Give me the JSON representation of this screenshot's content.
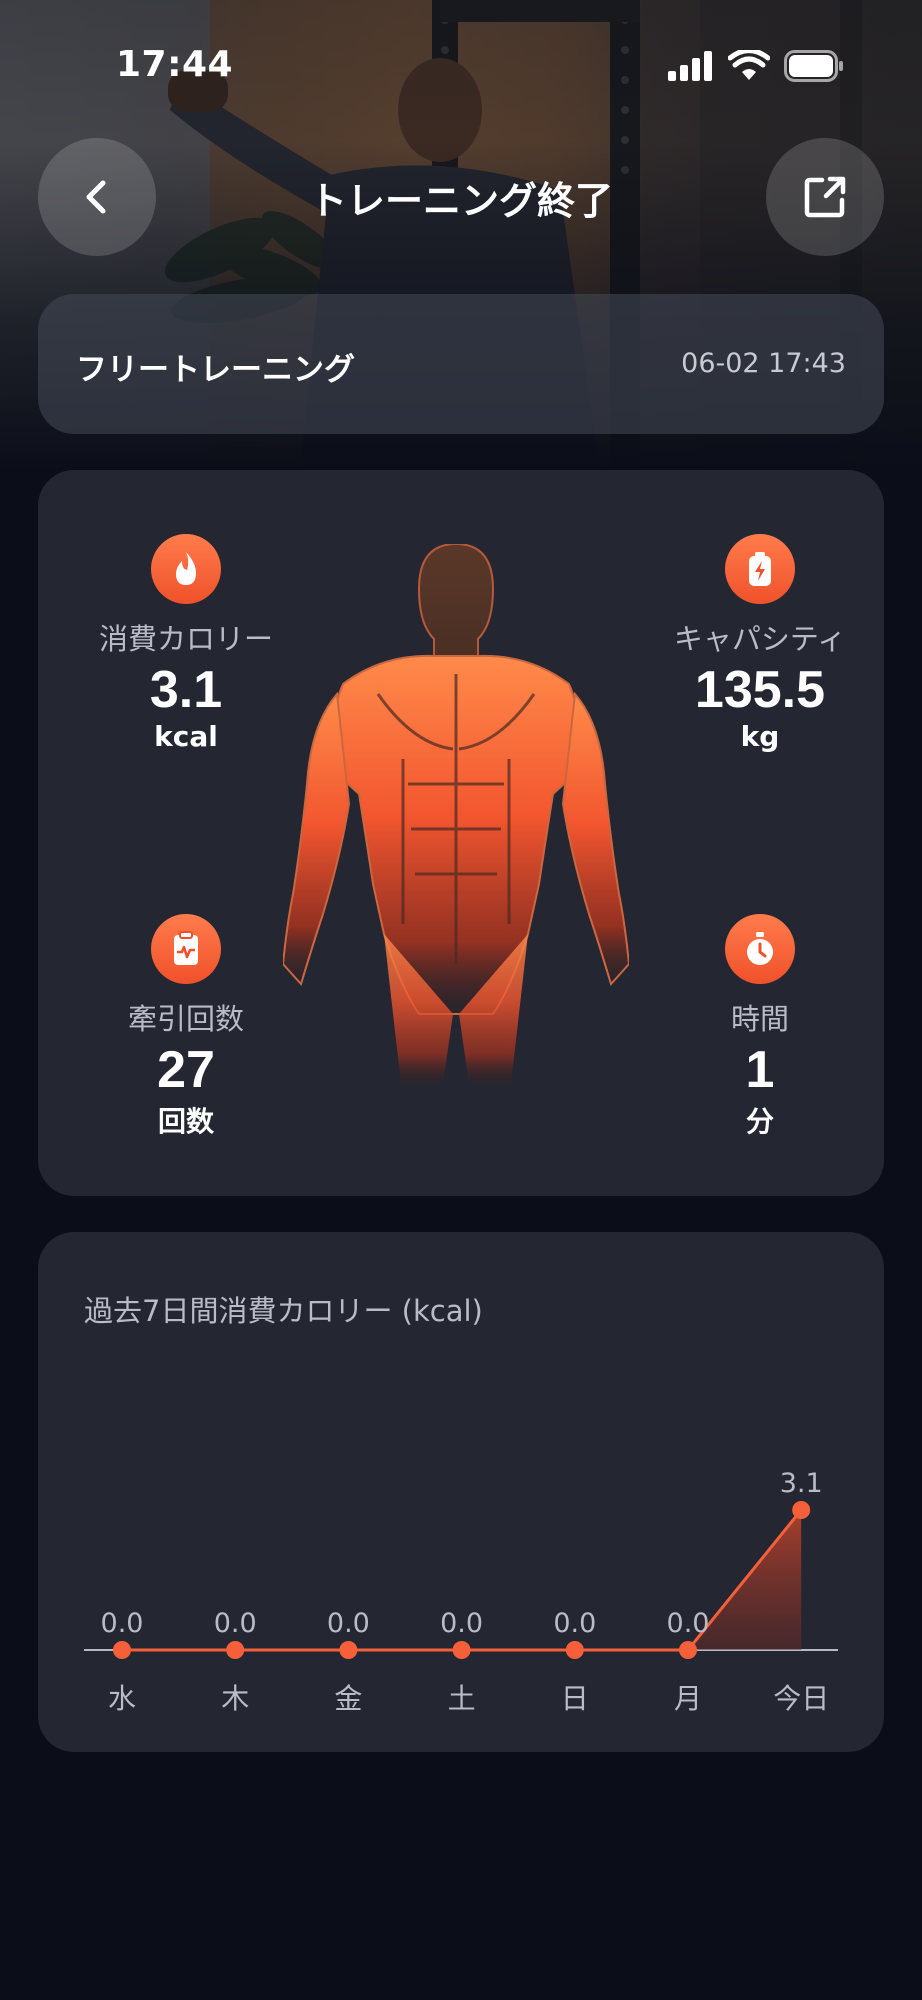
{
  "status_bar": {
    "time": "17:44"
  },
  "header": {
    "title": "トレーニング終了"
  },
  "session": {
    "name": "フリートレーニング",
    "datetime": "06-02 17:43"
  },
  "stats": {
    "calories": {
      "label": "消費カロリー",
      "value": "3.1",
      "unit": "kcal",
      "icon": "flame-icon"
    },
    "capacity": {
      "label": "キャパシティ",
      "value": "135.5",
      "unit": "kg",
      "icon": "battery-bolt-icon"
    },
    "pulls": {
      "label": "牽引回数",
      "value": "27",
      "unit": "回数",
      "icon": "clipboard-pulse-icon"
    },
    "duration": {
      "label": "時間",
      "value": "1",
      "unit": "分",
      "icon": "stopwatch-icon"
    }
  },
  "colors": {
    "accent": "#f5603a",
    "card": "#242732",
    "background": "#0b0e18"
  },
  "chart_data": {
    "type": "line",
    "title": "過去7日間消費カロリー (kcal)",
    "categories": [
      "水",
      "木",
      "金",
      "土",
      "日",
      "月",
      "今日"
    ],
    "values": [
      0.0,
      0.0,
      0.0,
      0.0,
      0.0,
      0.0,
      3.1
    ],
    "data_labels": [
      "0.0",
      "0.0",
      "0.0",
      "0.0",
      "0.0",
      "0.0",
      "3.1"
    ],
    "ylim": [
      0,
      3.1
    ],
    "grid": false
  }
}
